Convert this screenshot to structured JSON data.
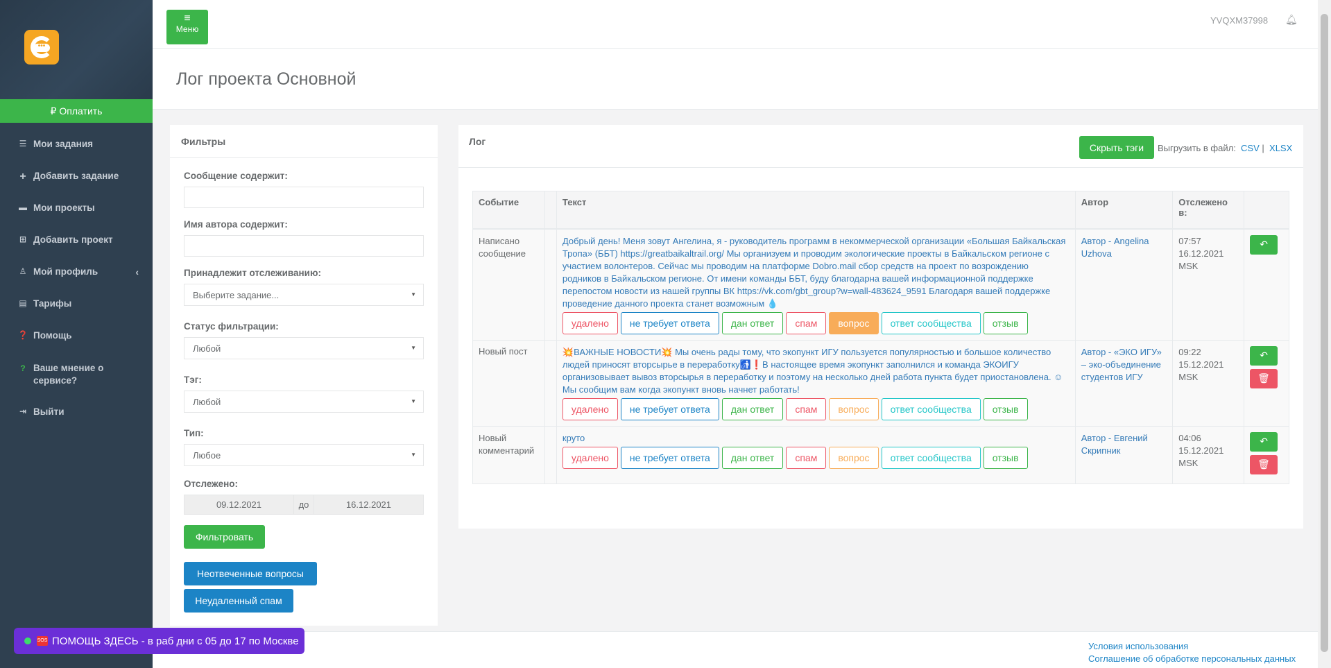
{
  "sidebar": {
    "pay_label": "Оплатить",
    "items": [
      {
        "label": "Мои задания",
        "icon": "list-icon"
      },
      {
        "label": "Добавить задание",
        "icon": "plus-icon"
      },
      {
        "label": "Мои проекты",
        "icon": "briefcase-icon"
      },
      {
        "label": "Добавить проект",
        "icon": "plus-square-icon"
      },
      {
        "label": "Мой профиль",
        "icon": "user-icon"
      },
      {
        "label": "Тарифы",
        "icon": "table-icon"
      },
      {
        "label": "Помощь",
        "icon": "question-circle-icon"
      },
      {
        "label": "Ваше мнение о сервисе?",
        "icon": "question-icon"
      },
      {
        "label": "Выйти",
        "icon": "sign-out-icon"
      }
    ]
  },
  "topbar": {
    "menu_label": "Меню",
    "user_id": "YVQXM37998"
  },
  "page_title": "Лог проекта Основной",
  "filters": {
    "title": "Фильтры",
    "message_label": "Сообщение содержит:",
    "author_label": "Имя автора содержит:",
    "tracking_label": "Принадлежит отслеживанию:",
    "tracking_value": "Выберите задание...",
    "status_label": "Статус фильтрации:",
    "status_value": "Любой",
    "tag_label": "Тэг:",
    "tag_value": "Любой",
    "type_label": "Тип:",
    "type_value": "Любое",
    "tracked_label": "Отслежено:",
    "date_from": "09.12.2021",
    "date_sep": "до",
    "date_to": "16.12.2021",
    "filter_button": "Фильтровать",
    "unanswered_button": "Неотвеченные вопросы",
    "spam_button": "Неудаленный спам"
  },
  "log": {
    "title": "Лог",
    "hide_tags_button": "Скрыть тэги",
    "export_label": "Выгрузить в файл:",
    "export_csv": "CSV",
    "export_sep": "|",
    "export_xlsx": "XLSX",
    "columns": [
      "Событие",
      "Текст",
      "Автор",
      "Отслежено в:"
    ],
    "tag_labels": [
      "удалено",
      "не требует ответа",
      "дан ответ",
      "спам",
      "вопрос",
      "ответ сообщества",
      "отзыв"
    ],
    "rows": [
      {
        "event": "Написано сообщение",
        "text": "Добрый день! Меня зовут Ангелина, я - руководитель программ в некоммерческой организации «Большая Байкальская Тропа» (ББТ) https://greatbaikaltrail.org/ Мы организуем и проводим экологические проекты в Байкальском регионе с участием волонтеров. Сейчас мы проводим на платформе Dobro.mail сбор средств на проект по возрождению родников в Байкальском регионе. От имени команды ББТ, буду благодарна вашей информационной поддержке перепостом новости из нашей группы ВК https://vk.com/gbt_group?w=wall-483624_9591 Благодаря вашей поддержке проведение данного проекта станет возможным 💧",
        "author": "Автор - Angelina Uzhova",
        "time": "07:57",
        "date": "16.12.2021",
        "tz": "MSK"
      },
      {
        "event": "Новый пост",
        "text": "💥ВАЖНЫЕ НОВОСТИ💥 Мы очень рады тому, что экопункт ИГУ пользуется популярностью и большое количество людей приносят вторсырье в переработку🚮❗В настоящее время экопункт заполнился и команда ЭКОИГУ организовывает вывоз вторсырья в переработку и поэтому на несколько дней работа пункта будет приостановлена. ☺Мы сообщим вам когда экопункт вновь начнет работать!",
        "author": "Автор - «ЭКО ИГУ» – эко-объединение студентов ИГУ",
        "time": "09:22",
        "date": "15.12.2021",
        "tz": "MSK"
      },
      {
        "event": "Новый комментарий",
        "text": "круто",
        "author": "Автор - Евгений Скрипник",
        "time": "04:06",
        "date": "15.12.2021",
        "tz": "MSK"
      }
    ]
  },
  "footer": {
    "terms": "Условия использования",
    "privacy": "Соглашение об обработке персональных данных"
  },
  "help_chip": {
    "label": "ПОМОЩЬ ЗДЕСЬ - в раб дни с 05 до 17 по Москве"
  },
  "colors": {
    "sidebar_bg": "#2f4050",
    "accent_green": "#3cb54a",
    "accent_blue": "#1c84c6",
    "danger_red": "#ed5565",
    "warning_orange": "#f8ac59",
    "info_teal": "#23c6c8",
    "help_chip_bg": "#6b2fd7"
  }
}
